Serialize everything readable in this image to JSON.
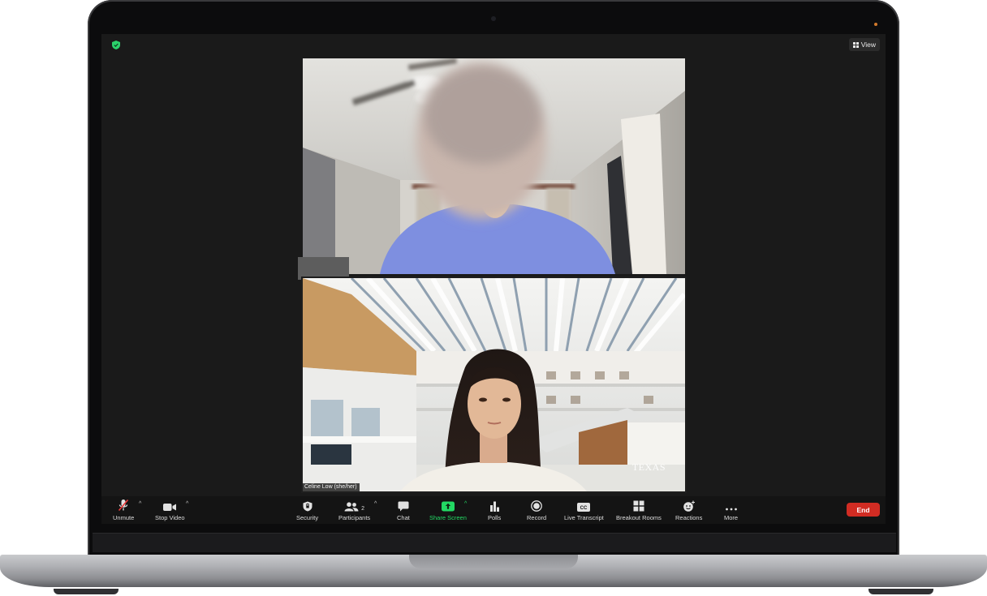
{
  "top_bar": {
    "view_label": "View"
  },
  "participants": [
    {
      "name": ""
    },
    {
      "name": "Celine Low (she/her)",
      "watermark": "TEXAS"
    }
  ],
  "toolbar": {
    "unmute": "Unmute",
    "stop_video": "Stop Video",
    "security": "Security",
    "participants": "Participants",
    "participants_count": "2",
    "chat": "Chat",
    "share_screen": "Share Screen",
    "polls": "Polls",
    "record": "Record",
    "live_transcript": "Live Transcript",
    "breakout_rooms": "Breakout Rooms",
    "reactions": "Reactions",
    "more": "More",
    "end": "End"
  },
  "colors": {
    "share_green": "#23d964",
    "end_red": "#d12c23",
    "encryption_green": "#2bd16b"
  }
}
